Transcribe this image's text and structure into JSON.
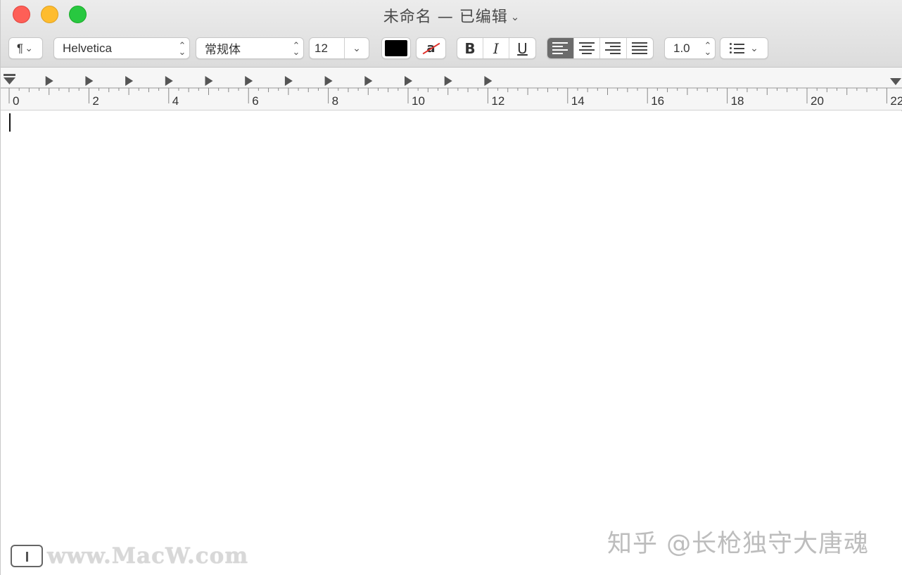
{
  "window": {
    "title": "未命名 — 已编辑",
    "title_chevron": "⌄"
  },
  "toolbar": {
    "paragraph_symbol": "¶",
    "font_family": "Helvetica",
    "font_style": "常规体",
    "font_size": "12",
    "text_color": "#000000",
    "bold_label": "B",
    "italic_label": "I",
    "underline_label": "U",
    "highlight_label": "a",
    "alignment_selected": "left",
    "line_spacing": "1.0",
    "dropdown_glyph": "⌄",
    "updown_up": "⌃",
    "updown_down": "⌄"
  },
  "ruler": {
    "numbers": [
      "0",
      "2",
      "4",
      "6",
      "8",
      "10",
      "12",
      "14",
      "16",
      "18",
      "20",
      "22"
    ]
  },
  "watermarks": {
    "left_text": "www.MacW.com",
    "right_text": "知乎 @长枪独守大唐魂"
  }
}
